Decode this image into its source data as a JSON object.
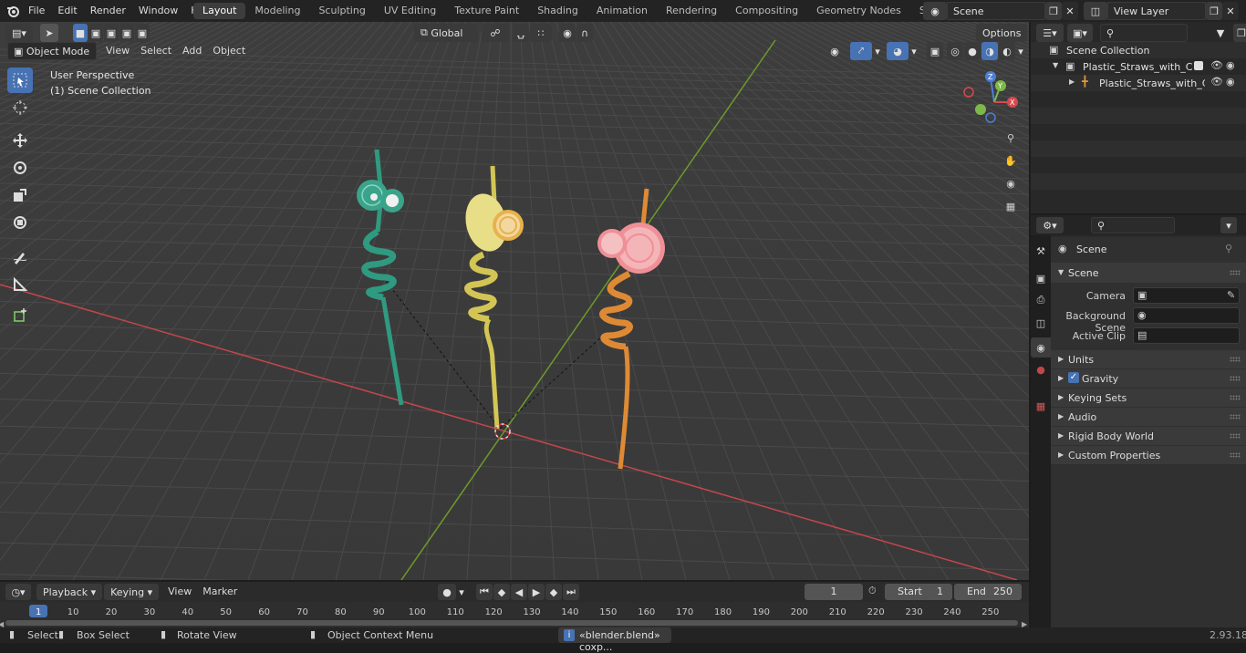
{
  "menu": [
    "File",
    "Edit",
    "Render",
    "Window",
    "Help"
  ],
  "workspaces": [
    "Layout",
    "Modeling",
    "Sculpting",
    "UV Editing",
    "Texture Paint",
    "Shading",
    "Animation",
    "Rendering",
    "Compositing",
    "Geometry Nodes",
    "Scripting"
  ],
  "active_workspace": "Layout",
  "scene_name": "Scene",
  "view_layer": "View Layer",
  "viewport": {
    "mode": "Object Mode",
    "menus": [
      "View",
      "Select",
      "Add",
      "Object"
    ],
    "transform_orientation": "Global",
    "options_label": "Options",
    "overlay_text_line1": "User Perspective",
    "overlay_text_line2": "(1) Scene Collection"
  },
  "outliner": {
    "root": "Scene Collection",
    "collection": "Plastic_Straws_with_Citrus_Fr",
    "object": "Plastic_Straws_with_Citr..."
  },
  "properties": {
    "header": "Scene",
    "panel": "Scene",
    "camera_label": "Camera",
    "background_label": "Background Scene",
    "clip_label": "Active Clip",
    "subpanels": [
      "Units",
      "Gravity",
      "Keying Sets",
      "Audio",
      "Rigid Body World",
      "Custom Properties"
    ]
  },
  "timeline": {
    "menus": [
      "Playback",
      "Keying",
      "View",
      "Marker"
    ],
    "current_frame": "1",
    "start_label": "Start",
    "start": "1",
    "end_label": "End",
    "end": "250",
    "ticks": [
      "1",
      "10",
      "20",
      "30",
      "40",
      "50",
      "60",
      "70",
      "80",
      "90",
      "100",
      "110",
      "120",
      "130",
      "140",
      "150",
      "160",
      "170",
      "180",
      "190",
      "200",
      "210",
      "220",
      "230",
      "240",
      "250"
    ]
  },
  "status": {
    "select": "Select",
    "box_select": "Box Select",
    "rotate": "Rotate View",
    "context_menu": "Object Context Menu",
    "message": "«blender.blend» coxp...",
    "version": "2.93.18"
  },
  "colors": {
    "accent": "#4772b3",
    "x_axis": "#c5464c",
    "y_axis": "#6e9a2a",
    "teal_straw": "#2f9a80",
    "yellow_straw": "#d2c555",
    "orange_straw": "#de8a35",
    "pink_citrus": "#f2a3a8"
  }
}
